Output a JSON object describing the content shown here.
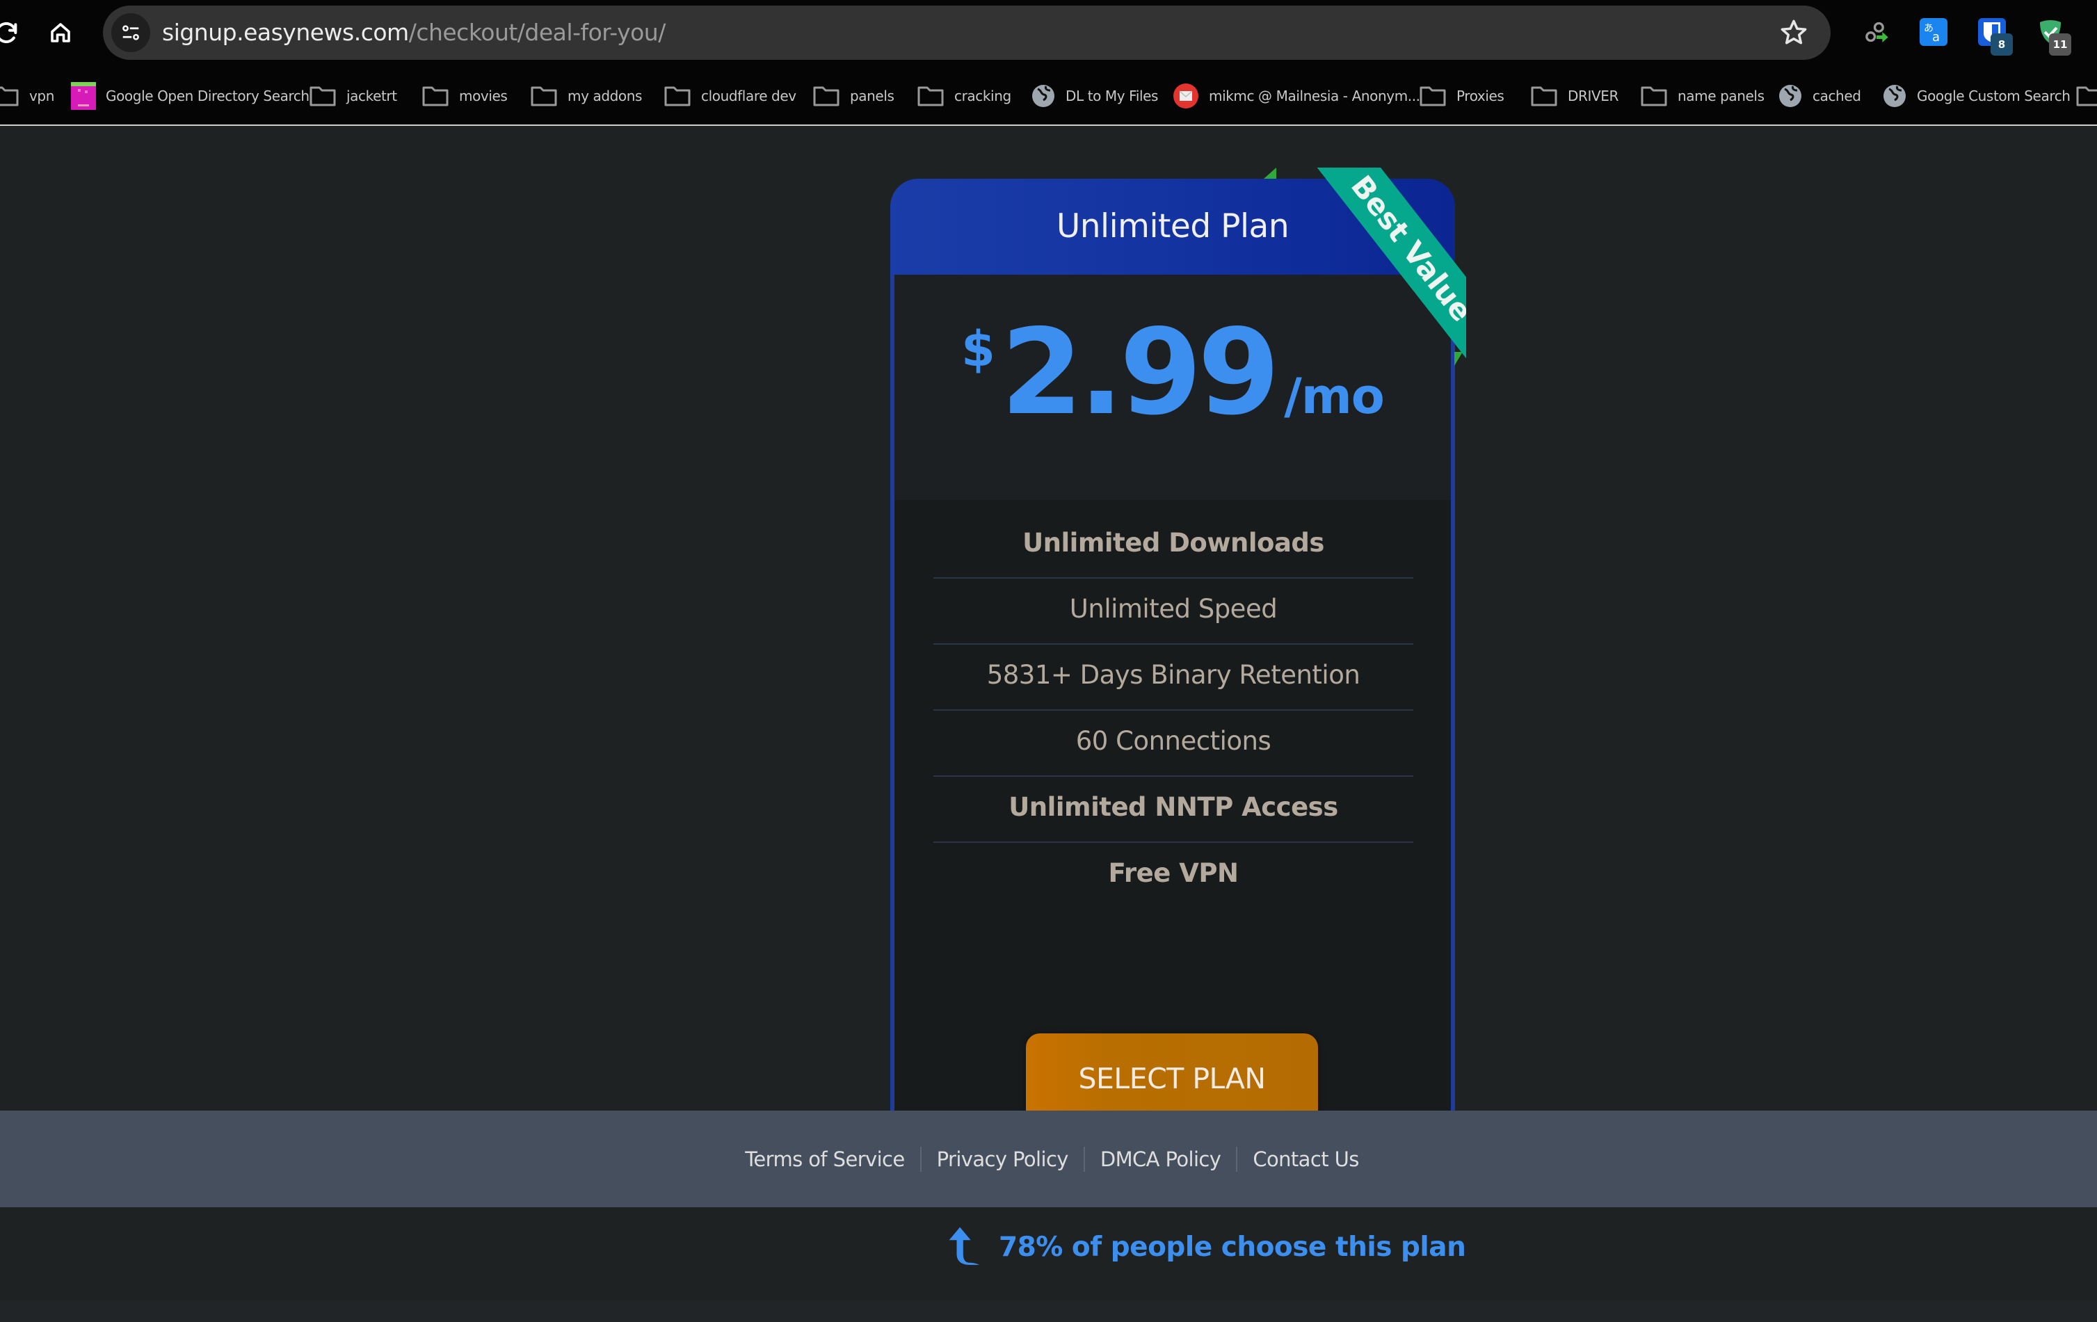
{
  "browser": {
    "url_host": "signup.easynews.com",
    "url_path": "/checkout/deal-for-you/",
    "extensions": [
      {
        "name": "link-redirect-extension"
      },
      {
        "name": "translate-extension"
      },
      {
        "name": "bitwarden-extension",
        "badge": "8"
      },
      {
        "name": "adguard-extension",
        "badge": "11"
      }
    ],
    "bookmarks": [
      {
        "label": "vpn",
        "icon": "folder"
      },
      {
        "label": "Google Open Directory Search",
        "icon": "favicon-pink"
      },
      {
        "label": "jacketrt",
        "icon": "folder"
      },
      {
        "label": "movies",
        "icon": "folder"
      },
      {
        "label": "my addons",
        "icon": "folder"
      },
      {
        "label": "cloudflare dev",
        "icon": "folder"
      },
      {
        "label": "panels",
        "icon": "folder"
      },
      {
        "label": "cracking",
        "icon": "folder"
      },
      {
        "label": "DL to My Files",
        "icon": "globe"
      },
      {
        "label": "mikmc @ Mailnesia - Anonym...",
        "icon": "mail-red"
      },
      {
        "label": "Proxies",
        "icon": "folder"
      },
      {
        "label": "DRIVER",
        "icon": "folder"
      },
      {
        "label": "name panels",
        "icon": "folder"
      },
      {
        "label": "cached",
        "icon": "globe"
      },
      {
        "label": "Google Custom Search",
        "icon": "globe"
      }
    ]
  },
  "plan": {
    "title": "Unlimited Plan",
    "ribbon": "Best Value",
    "currency": "$",
    "amount": "2.99",
    "period": "/mo",
    "features": [
      {
        "text": "Unlimited Downloads",
        "bold": true
      },
      {
        "text": "Unlimited Speed",
        "bold": false
      },
      {
        "text": "5831+ Days Binary Retention",
        "bold": false
      },
      {
        "text": "60 Connections",
        "bold": false
      },
      {
        "text": "Unlimited NNTP Access",
        "bold": true
      },
      {
        "text": "Free VPN",
        "bold": true
      }
    ],
    "cta": "SELECT PLAN"
  },
  "footer": {
    "links": [
      "Terms of Service",
      "Privacy Policy",
      "DMCA Policy",
      "Contact Us"
    ]
  },
  "popularity": {
    "text": "78% of people choose this plan"
  },
  "colors": {
    "accent_blue": "#3d8fef",
    "header_blue": "#1a3da8",
    "ribbon_green": "#05a78d",
    "cta_orange": "#c97201",
    "footer_bg": "#454f5e",
    "page_bg": "#1f2223"
  }
}
